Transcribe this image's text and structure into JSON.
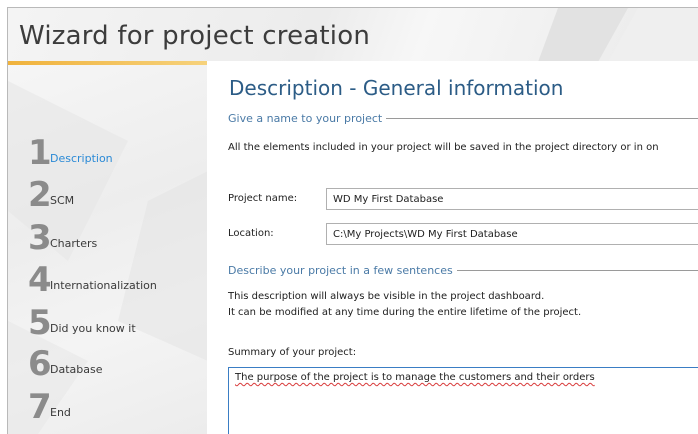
{
  "window": {
    "title": "Wizard for project creation"
  },
  "sidebar": {
    "steps": [
      {
        "num": "1",
        "label": "Description",
        "active": true
      },
      {
        "num": "2",
        "label": "SCM"
      },
      {
        "num": "3",
        "label": "Charters"
      },
      {
        "num": "4",
        "label": "Internationalization"
      },
      {
        "num": "5",
        "label": "Did you know it"
      },
      {
        "num": "6",
        "label": "Database"
      },
      {
        "num": "7",
        "label": "End"
      }
    ]
  },
  "main": {
    "heading": "Description - General information",
    "name_section": {
      "title": "Give a name to your project",
      "info": "All the elements included in your project will be saved in the project directory or in on"
    },
    "project_name": {
      "label": "Project name:",
      "value": "WD My First Database"
    },
    "location": {
      "label": "Location:",
      "value": "C:\\My Projects\\WD My First Database"
    },
    "describe_section": {
      "title": "Describe your project in a few sentences",
      "line1": "This description will always be visible in the project dashboard.",
      "line2": "It can be modified at any time during the entire lifetime of the project."
    },
    "summary": {
      "label": "Summary of your project:",
      "value": "The purpose of the project is to manage the customers and their orders"
    }
  },
  "colors": {
    "accent": "#2b8ad6",
    "heading": "#2c5c86",
    "stripe": "#f0b23c"
  }
}
